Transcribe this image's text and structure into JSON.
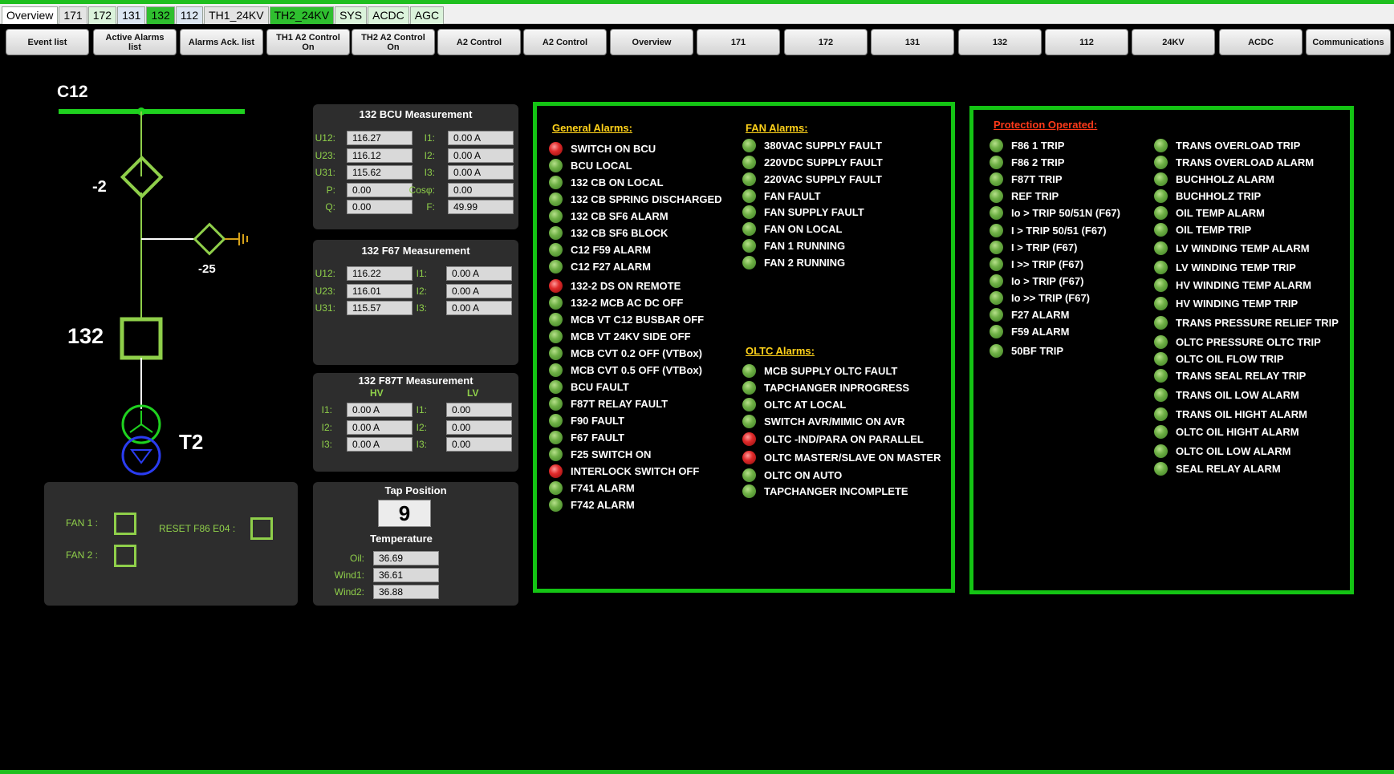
{
  "top_tabs": [
    {
      "label": "Overview",
      "style": "white"
    },
    {
      "label": "171",
      "style": "gray"
    },
    {
      "label": "172",
      "style": "lg"
    },
    {
      "label": "131",
      "style": "blue"
    },
    {
      "label": "132",
      "style": "green"
    },
    {
      "label": "112",
      "style": "blue"
    },
    {
      "label": "TH1_24KV",
      "style": "gray"
    },
    {
      "label": "TH2_24KV",
      "style": "green"
    },
    {
      "label": "SYS",
      "style": "lg"
    },
    {
      "label": "ACDC",
      "style": "lg"
    },
    {
      "label": "AGC",
      "style": "lg"
    }
  ],
  "nav_buttons": [
    "Event list",
    "Active Alarms\nlist",
    "Alarms Ack. list",
    "TH1 A2 Control\nOn",
    "TH2 A2 Control\nOn",
    "A2 Control",
    "A2 Control",
    "Overview",
    "171",
    "172",
    "131",
    "132",
    "112",
    "24KV",
    "ACDC",
    "Communications"
  ],
  "single_line": {
    "busbar_label": "C12",
    "disconnector_label": "-2",
    "earth_switch_label": "-25",
    "breaker_label": "132",
    "transformer_label": "T2"
  },
  "bcu": {
    "title": "132 BCU Measurement",
    "rows": [
      {
        "l1": "U12:",
        "v1": "116.27",
        "l2": "I1:",
        "v2": "0.00 A"
      },
      {
        "l1": "U23:",
        "v1": "116.12",
        "l2": "I2:",
        "v2": "0.00 A"
      },
      {
        "l1": "U31:",
        "v1": "115.62",
        "l2": "I3:",
        "v2": "0.00 A"
      },
      {
        "l1": "P:",
        "v1": "0.00",
        "l2": "Cosφ:",
        "v2": "0.00"
      },
      {
        "l1": "Q:",
        "v1": "0.00",
        "l2": "F:",
        "v2": "49.99"
      }
    ]
  },
  "f67": {
    "title": "132 F67  Measurement",
    "rows": [
      {
        "l1": "U12:",
        "v1": "116.22",
        "l2": "I1:",
        "v2": "0.00 A"
      },
      {
        "l1": "U23:",
        "v1": "116.01",
        "l2": "I2:",
        "v2": "0.00 A"
      },
      {
        "l1": "U31:",
        "v1": "115.57",
        "l2": "I3:",
        "v2": "0.00 A"
      }
    ]
  },
  "f87t": {
    "title": "132 F87T Measurement",
    "hv": "HV",
    "lv": "LV",
    "rows": [
      {
        "l1": "I1:",
        "v1": "0.00 A",
        "l2": "I1:",
        "v2": "0.00"
      },
      {
        "l1": "I2:",
        "v1": "0.00 A",
        "l2": "I2:",
        "v2": "0.00"
      },
      {
        "l1": "I3:",
        "v1": "0.00 A",
        "l2": "I3:",
        "v2": "0.00"
      }
    ]
  },
  "fan_panel": {
    "fan1_label": "FAN 1 :",
    "fan2_label": "FAN 2 :",
    "reset_label": "RESET F86 E04 :"
  },
  "tap": {
    "title": "Tap Position",
    "value": "9",
    "temp_title": "Temperature",
    "temps": [
      {
        "label": "Oil:",
        "value": "36.69"
      },
      {
        "label": "Wind1:",
        "value": "36.61"
      },
      {
        "label": "Wind2:",
        "value": "36.88"
      }
    ]
  },
  "colors": {
    "ok_led": "#6fb046",
    "alarm_led": "#e02a2a",
    "frame_green": "#14c414",
    "header_yellow": "#ffd21a",
    "header_red": "#ff3a1a"
  },
  "general_alarms": {
    "title": "General Alarms:",
    "items": [
      {
        "label": "SWITCH ON BCU",
        "state": "alarm"
      },
      {
        "label": "BCU LOCAL",
        "state": "ok"
      },
      {
        "label": "132 CB ON LOCAL",
        "state": "ok"
      },
      {
        "label": "132 CB SPRING DISCHARGED",
        "state": "ok"
      },
      {
        "label": "132 CB SF6 ALARM",
        "state": "ok"
      },
      {
        "label": "132 CB SF6 BLOCK",
        "state": "ok"
      },
      {
        "label": "C12 F59 ALARM",
        "state": "ok"
      },
      {
        "label": "C12 F27 ALARM",
        "state": "ok"
      },
      {
        "label": "132-2 DS ON REMOTE",
        "state": "alarm"
      },
      {
        "label": "132-2 MCB AC DC OFF",
        "state": "ok"
      },
      {
        "label": "MCB VT C12 BUSBAR OFF",
        "state": "ok"
      },
      {
        "label": "MCB VT 24KV SIDE OFF",
        "state": "ok"
      },
      {
        "label": "MCB CVT 0.2 OFF (VTBox)",
        "state": "ok"
      },
      {
        "label": "MCB CVT 0.5 OFF (VTBox)",
        "state": "ok"
      },
      {
        "label": "BCU FAULT",
        "state": "ok"
      },
      {
        "label": "F87T RELAY FAULT",
        "state": "ok"
      },
      {
        "label": "F90 FAULT",
        "state": "ok"
      },
      {
        "label": "F67 FAULT",
        "state": "ok"
      },
      {
        "label": "F25 SWITCH ON",
        "state": "ok"
      },
      {
        "label": "INTERLOCK SWITCH OFF",
        "state": "alarm"
      },
      {
        "label": "F741 ALARM",
        "state": "ok"
      },
      {
        "label": "F742 ALARM",
        "state": "ok"
      }
    ]
  },
  "fan_alarms": {
    "title": "FAN Alarms:",
    "items": [
      {
        "label": "380VAC SUPPLY FAULT",
        "state": "ok"
      },
      {
        "label": "220VDC SUPPLY FAULT",
        "state": "ok"
      },
      {
        "label": "220VAC SUPPLY FAULT",
        "state": "ok"
      },
      {
        "label": "FAN FAULT",
        "state": "ok"
      },
      {
        "label": "FAN SUPPLY FAULT",
        "state": "ok"
      },
      {
        "label": "FAN ON LOCAL",
        "state": "ok"
      },
      {
        "label": "FAN 1 RUNNING",
        "state": "ok"
      },
      {
        "label": "FAN 2 RUNNING",
        "state": "ok"
      }
    ]
  },
  "oltc_alarms": {
    "title": "OLTC Alarms:",
    "items": [
      {
        "label": "MCB SUPPLY OLTC FAULT",
        "state": "ok"
      },
      {
        "label": "TAPCHANGER INPROGRESS",
        "state": "ok"
      },
      {
        "label": "OLTC AT LOCAL",
        "state": "ok"
      },
      {
        "label": "SWITCH AVR/MIMIC ON AVR",
        "state": "ok"
      },
      {
        "label": "OLTC -IND/PARA ON PARALLEL",
        "state": "alarm"
      },
      {
        "label": "OLTC MASTER/SLAVE ON MASTER",
        "state": "alarm"
      },
      {
        "label": "OLTC ON AUTO",
        "state": "ok"
      },
      {
        "label": "TAPCHANGER INCOMPLETE",
        "state": "ok"
      }
    ]
  },
  "protection": {
    "title": "Protection Operated:",
    "col1": [
      {
        "label": "F86 1 TRIP",
        "state": "ok"
      },
      {
        "label": "F86 2 TRIP",
        "state": "ok"
      },
      {
        "label": "F87T TRIP",
        "state": "ok"
      },
      {
        "label": "REF TRIP",
        "state": "ok"
      },
      {
        "label": "Io > TRIP 50/51N (F67)",
        "state": "ok"
      },
      {
        "label": "I > TRIP 50/51 (F67)",
        "state": "ok"
      },
      {
        "label": "I > TRIP (F67)",
        "state": "ok"
      },
      {
        "label": "I >> TRIP (F67)",
        "state": "ok"
      },
      {
        "label": "Io > TRIP (F67)",
        "state": "ok"
      },
      {
        "label": "Io >> TRIP (F67)",
        "state": "ok"
      },
      {
        "label": "F27 ALARM",
        "state": "ok"
      },
      {
        "label": "F59 ALARM",
        "state": "ok"
      },
      {
        "label": "50BF TRIP",
        "state": "ok"
      }
    ],
    "col2": [
      {
        "label": "TRANS OVERLOAD TRIP",
        "state": "ok"
      },
      {
        "label": "TRANS OVERLOAD ALARM",
        "state": "ok"
      },
      {
        "label": "BUCHHOLZ ALARM",
        "state": "ok"
      },
      {
        "label": "BUCHHOLZ TRIP",
        "state": "ok"
      },
      {
        "label": "OIL TEMP ALARM",
        "state": "ok"
      },
      {
        "label": "OIL TEMP TRIP",
        "state": "ok"
      },
      {
        "label": "LV WINDING TEMP ALARM",
        "state": "ok"
      },
      {
        "label": "LV WINDING TEMP TRIP",
        "state": "ok"
      },
      {
        "label": "HV WINDING TEMP ALARM",
        "state": "ok"
      },
      {
        "label": "HV WINDING TEMP TRIP",
        "state": "ok"
      },
      {
        "label": "TRANS PRESSURE RELIEF TRIP",
        "state": "ok"
      },
      {
        "label": "OLTC PRESSURE OLTC TRIP",
        "state": "ok"
      },
      {
        "label": "OLTC OIL FLOW TRIP",
        "state": "ok"
      },
      {
        "label": "TRANS SEAL RELAY TRIP",
        "state": "ok"
      },
      {
        "label": "TRANS OIL LOW ALARM",
        "state": "ok"
      },
      {
        "label": "TRANS OIL HIGHT ALARM",
        "state": "ok"
      },
      {
        "label": "OLTC OIL HIGHT ALARM",
        "state": "ok"
      },
      {
        "label": "OLTC OIL LOW ALARM",
        "state": "ok"
      },
      {
        "label": "SEAL RELAY ALARM",
        "state": "ok"
      }
    ]
  }
}
